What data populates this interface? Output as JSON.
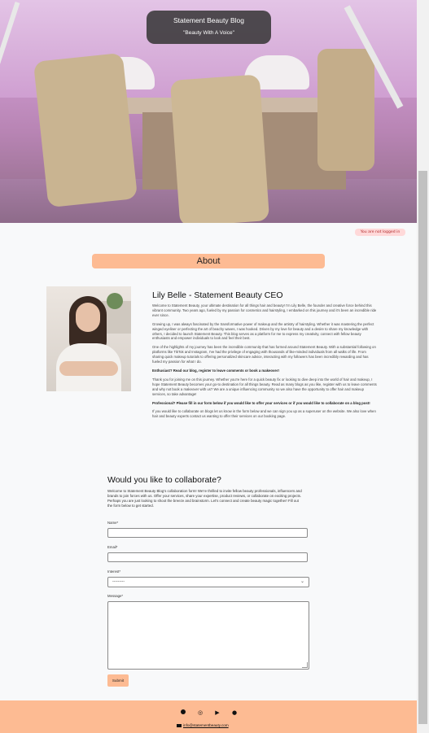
{
  "hero": {
    "title": "Statement Beauty Blog",
    "tagline": "\"Beauty With A Voice\""
  },
  "status": {
    "login": "You are not logged in"
  },
  "about": {
    "heading": "About",
    "bio_title": "Lily Belle - Statement Beauty CEO",
    "paragraphs": [
      "Welcome to Statement Beauty, your ultimate destination for all things hair and beauty! I'm Lily Belle, the founder and creative force behind this vibrant community. Two years ago, fueled by my passion for cosmetics and hairstyling, I embarked on this journey and it's been an incredible ride ever since.",
      "Growing up, I was always fascinated by the transformative power of makeup and the artistry of hairstyling. Whether it was mastering the perfect winged eyeliner or perfecting the art of beachy waves, I was hooked. Driven by my love for beauty and a desire to share my knowledge with others, I decided to launch Statement Beauty. This blog serves as a platform for me to express my creativity, connect with fellow beauty enthusiasts and empower individuals to look and feel their best.",
      "One of the highlights of my journey has been the incredible community that has formed around Statement Beauty. With a substantial following on platforms like TikTok and Instagram, I've had the privilege of engaging with thousands of like-minded individuals from all walks of life. From sharing quick makeup tutorials to offering personalized skincare advice, interacting with my followers has been incredibly rewarding and has fueled my passion for what I do.",
      "Enthusiast? Read our blog, register to leave comments or book a makeover!",
      "Thank you for joining me on this journey. Whether you're here for a quick beauty fix or looking to dive deep into the world of hair and makeup, I hope Statement Beauty becomes your go-to destination for all things beauty. Read as many blogs as you like, register with us to leave comments and why not book a makeover with us? We are a unique influencing community so we also have the opportunity to offer hair and makeup services, so take advantage!",
      "Professional? Please fill in our form below if you would like to offer your services or if you would like to collaborate on a blog post!",
      "If you would like to collaborate on blogs let us know in the form below and we can sign you up as a superuser on the website. We also love when hair and beauty experts contact us wanting to offer their services on our booking page."
    ]
  },
  "collab": {
    "heading": "Would you like to collaborate?",
    "intro": "Welcome to Statement Beauty Blog's collaboration form! We're thrilled to invite fellow beauty professionals, influencers and brands to join forces with us. Offer your services, share your expertise, product reviews, or collaborate on exciting projects. Perhaps you are just looking to shoot the breeze and brainstorm. Let's connect and create beauty magic together! Fill out the form below to get started.",
    "name_label": "Name*",
    "email_label": "Email*",
    "interest_label": "Interest*",
    "interest_value": "---------",
    "message_label": "Message*",
    "submit_label": "Submit"
  },
  "footer": {
    "email": "info@statementbeauty.com",
    "social": [
      "facebook-icon",
      "instagram-icon",
      "youtube-icon",
      "github-icon"
    ]
  },
  "colors": {
    "accent": "#fdbb93",
    "background": "#f8f9fa"
  }
}
